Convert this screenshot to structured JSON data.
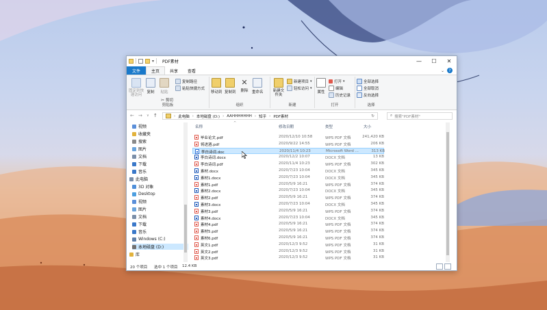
{
  "window": {
    "title": "PDF素材"
  },
  "ribbon_tabs": {
    "file": "文件",
    "home": "主页",
    "share": "共享",
    "view": "查看"
  },
  "ribbon": {
    "clipboard": {
      "label": "剪贴板",
      "pin": "固定到快速访问",
      "copy": "复制",
      "paste": "粘贴",
      "copy_path": "复制路径",
      "paste_shortcut": "粘贴快捷方式",
      "cut": "剪切"
    },
    "organize": {
      "label": "组织",
      "move_to": "移动到",
      "copy_to": "复制到",
      "delete": "删除",
      "rename": "重命名"
    },
    "new": {
      "label": "新建",
      "new_item": "新建项目",
      "easy_access": "轻松访问",
      "new_folder": "新建文件夹"
    },
    "open": {
      "label": "打开",
      "properties": "属性",
      "open": "打开",
      "edit": "编辑",
      "history": "历史记录"
    },
    "select": {
      "label": "选择",
      "select_all": "全部选择",
      "select_none": "全部取消",
      "invert": "反向选择"
    }
  },
  "address": {
    "crumbs": [
      "此电脑",
      "本地磁盘 (D:)",
      "AAHHHHHHH",
      "知乎",
      "PDF素材"
    ],
    "search_placeholder": "搜索\"PDF素材\""
  },
  "nav": {
    "items": [
      "视频",
      "收藏夹",
      "搜索",
      "图片",
      "文档",
      "下载",
      "音乐",
      "此电脑",
      "3D 对象",
      "Desktop",
      "视频",
      "图片",
      "文档",
      "下载",
      "音乐",
      "Windows (C:)",
      "本地磁盘 (D:)",
      "库"
    ],
    "selected_index": 16
  },
  "columns": {
    "name": "名称",
    "date": "修改日期",
    "type": "类型",
    "size": "大小"
  },
  "files": [
    {
      "name": "毕业论文.pdf",
      "date": "2020/12/10 10:58",
      "type": "WPS PDF 文档",
      "size": "241,420 KB",
      "kind": "pdf"
    },
    {
      "name": "将进酒.pdf",
      "date": "2020/9/22 14:55",
      "type": "WPS PDF 文档",
      "size": "206 KB",
      "kind": "pdf"
    },
    {
      "name": "李白诗词.doc",
      "date": "2020/11/4 10:23",
      "type": "Microsoft Word ...",
      "size": "313 KB",
      "kind": "doc"
    },
    {
      "name": "李白诗词.docx",
      "date": "2020/12/2 10:07",
      "type": "DOCX 文档",
      "size": "13 KB",
      "kind": "docx"
    },
    {
      "name": "李白诗词.pdf",
      "date": "2020/11/4 10:23",
      "type": "WPS PDF 文档",
      "size": "302 KB",
      "kind": "pdf"
    },
    {
      "name": "素材.docx",
      "date": "2020/7/23 10:04",
      "type": "DOCX 文档",
      "size": "345 KB",
      "kind": "docx"
    },
    {
      "name": "素材1.docx",
      "date": "2020/7/23 10:04",
      "type": "DOCX 文档",
      "size": "345 KB",
      "kind": "docx"
    },
    {
      "name": "素材1.pdf",
      "date": "2020/5/9 16:21",
      "type": "WPS PDF 文档",
      "size": "374 KB",
      "kind": "pdf"
    },
    {
      "name": "素材2.docx",
      "date": "2020/7/23 10:04",
      "type": "DOCX 文档",
      "size": "345 KB",
      "kind": "docx"
    },
    {
      "name": "素材2.pdf",
      "date": "2020/5/9 16:21",
      "type": "WPS PDF 文档",
      "size": "374 KB",
      "kind": "pdf"
    },
    {
      "name": "素材3.docx",
      "date": "2020/7/23 10:04",
      "type": "DOCX 文档",
      "size": "345 KB",
      "kind": "docx"
    },
    {
      "name": "素材3.pdf",
      "date": "2020/5/9 16:21",
      "type": "WPS PDF 文档",
      "size": "374 KB",
      "kind": "pdf"
    },
    {
      "name": "素材4.docx",
      "date": "2020/7/23 10:04",
      "type": "DOCX 文档",
      "size": "345 KB",
      "kind": "docx"
    },
    {
      "name": "素材4.pdf",
      "date": "2020/5/9 16:21",
      "type": "WPS PDF 文档",
      "size": "374 KB",
      "kind": "pdf"
    },
    {
      "name": "素材5.pdf",
      "date": "2020/5/9 16:21",
      "type": "WPS PDF 文档",
      "size": "374 KB",
      "kind": "pdf"
    },
    {
      "name": "素材6.pdf",
      "date": "2020/5/9 16:21",
      "type": "WPS PDF 文档",
      "size": "374 KB",
      "kind": "pdf"
    },
    {
      "name": "英文1.pdf",
      "date": "2020/12/3 9:52",
      "type": "WPS PDF 文档",
      "size": "31 KB",
      "kind": "pdf"
    },
    {
      "name": "英文2.pdf",
      "date": "2020/12/3 9:52",
      "type": "WPS PDF 文档",
      "size": "31 KB",
      "kind": "pdf"
    },
    {
      "name": "英文3.pdf",
      "date": "2020/12/3 9:52",
      "type": "WPS PDF 文档",
      "size": "31 KB",
      "kind": "pdf"
    }
  ],
  "highlighted_index": 2,
  "status": {
    "count": "20 个项目",
    "selected": "选中 1 个项目",
    "size": "12.4 KB"
  },
  "colors": {
    "accent": "#1979ca",
    "selection": "#cce8ff",
    "pdf": "#e0584b",
    "word": "#2b6fd6"
  }
}
